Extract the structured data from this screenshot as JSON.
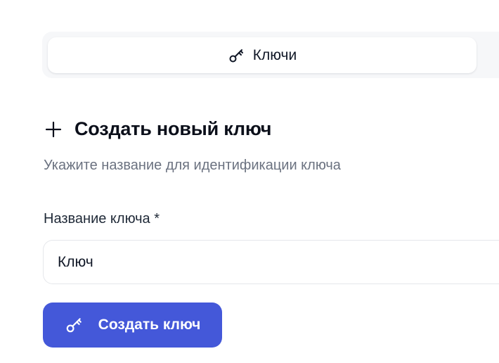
{
  "tabs": {
    "active": {
      "label": "Ключи",
      "icon": "key-icon"
    }
  },
  "section": {
    "title": "Создать новый ключ",
    "title_icon": "plus-icon",
    "subtitle": "Укажите название для идентификации ключа"
  },
  "form": {
    "name_label": "Название ключа *",
    "name_value": "Ключ",
    "submit_label": "Создать ключ",
    "submit_icon": "key-icon"
  },
  "colors": {
    "accent": "#4458d9",
    "muted_text": "#6b7280",
    "tab_bar_bg": "#f6f7f9"
  }
}
